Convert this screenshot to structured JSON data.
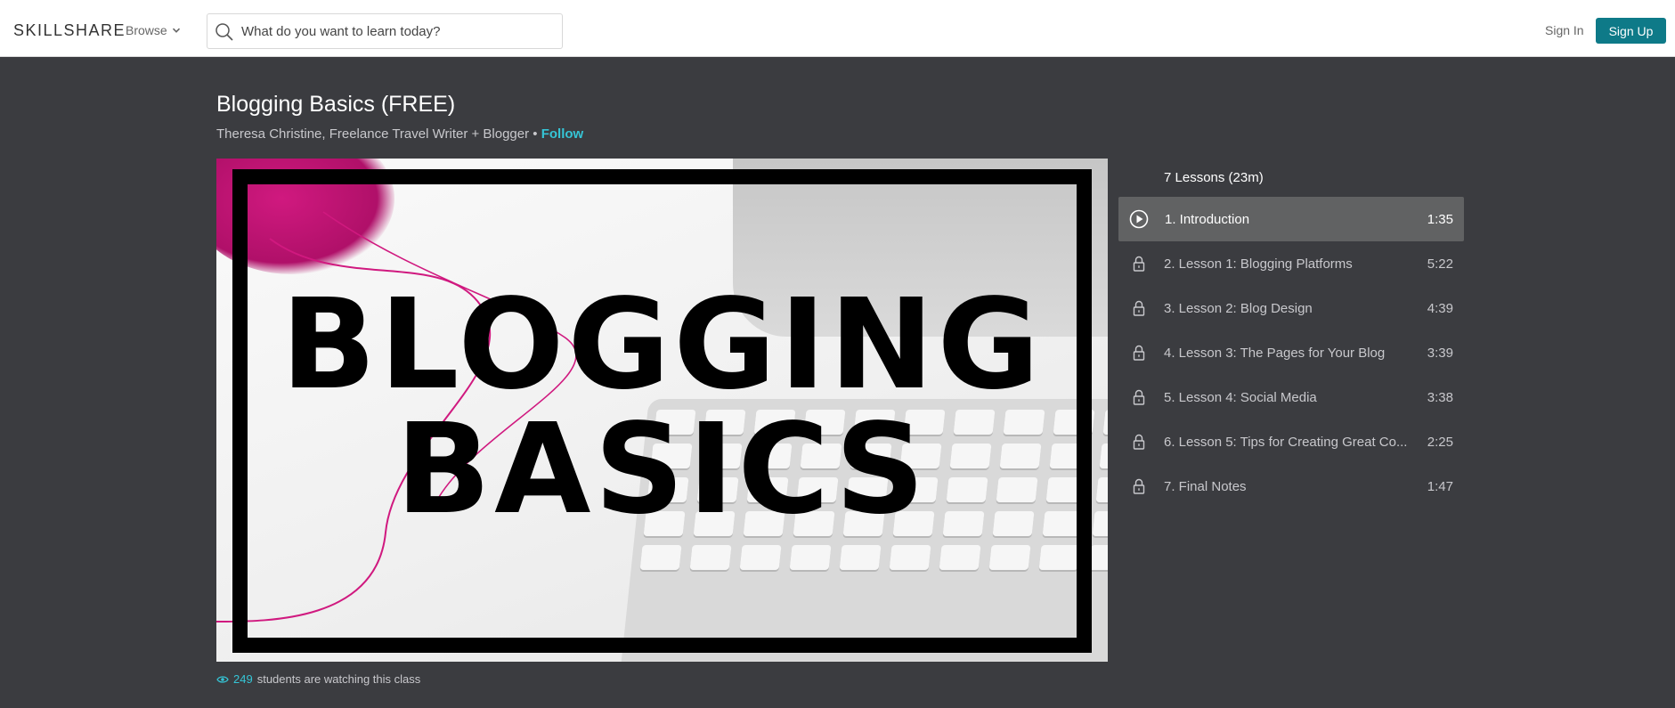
{
  "header": {
    "logo": "SKILLSHARE",
    "browse_label": "Browse",
    "search_placeholder": "What do you want to learn today?",
    "sign_in": "Sign In",
    "sign_up": "Sign Up",
    "brand_color": "#0e7a88"
  },
  "course": {
    "title": "Blogging Basics (FREE)",
    "author": "Theresa Christine, Freelance Travel Writer + Blogger",
    "separator": " • ",
    "follow": "Follow",
    "thumbnail": {
      "line1": "BLOGGING",
      "line2": "BASICS"
    },
    "watching_count": "249",
    "watching_text": "students are watching this class"
  },
  "lessons": {
    "header": "7 Lessons (23m)",
    "items": [
      {
        "label": "1. Introduction",
        "duration": "1:35",
        "icon": "play-icon",
        "active": true
      },
      {
        "label": "2. Lesson 1: Blogging Platforms",
        "duration": "5:22",
        "icon": "lock-icon"
      },
      {
        "label": "3. Lesson 2: Blog Design",
        "duration": "4:39",
        "icon": "lock-icon"
      },
      {
        "label": "4. Lesson 3: The Pages for Your Blog",
        "duration": "3:39",
        "icon": "lock-icon"
      },
      {
        "label": "5. Lesson 4: Social Media",
        "duration": "3:38",
        "icon": "lock-icon"
      },
      {
        "label": "6. Lesson 5: Tips for Creating Great Co...",
        "duration": "2:25",
        "icon": "lock-icon"
      },
      {
        "label": "7. Final Notes",
        "duration": "1:47",
        "icon": "lock-icon"
      }
    ]
  }
}
